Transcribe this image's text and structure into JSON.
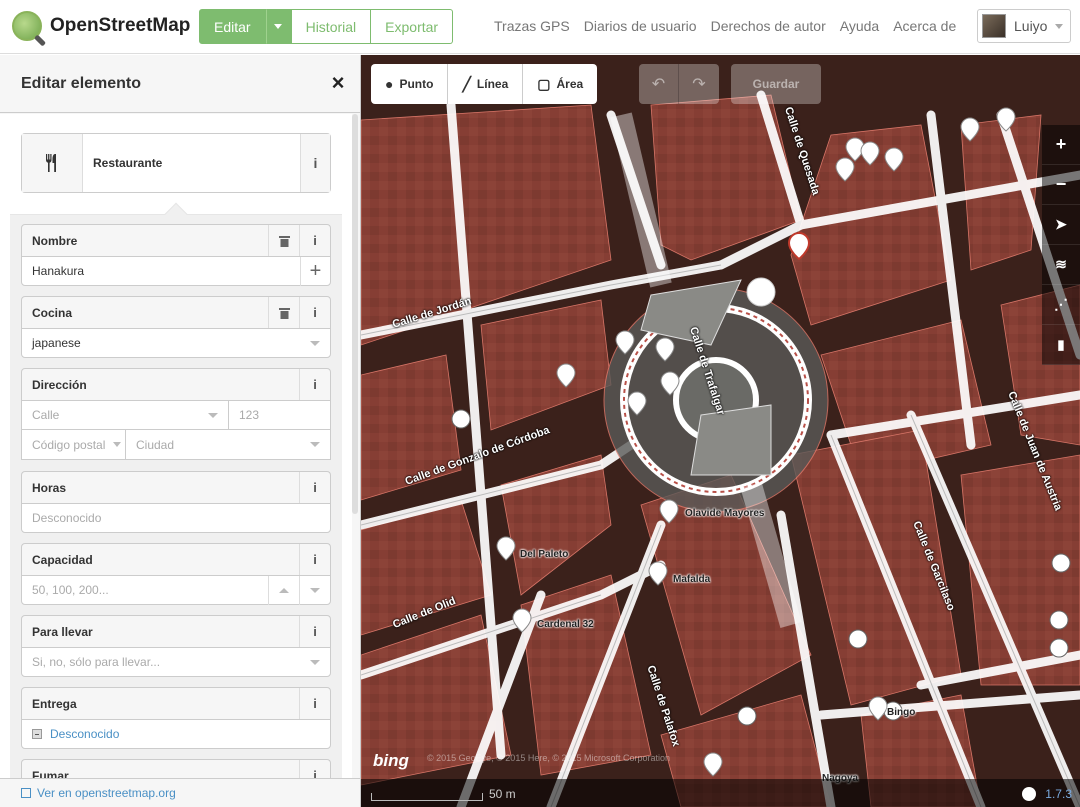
{
  "header": {
    "logo_text": "OpenStreetMap",
    "edit_label": "Editar",
    "history_label": "Historial",
    "export_label": "Exportar",
    "nav": [
      "Trazas GPS",
      "Diarios de usuario",
      "Derechos de autor",
      "Ayuda",
      "Acerca de"
    ],
    "user_name": "Luiyo"
  },
  "sidebar": {
    "title": "Editar elemento",
    "close_glyph": "×",
    "preset": {
      "icon": "restaurant-icon",
      "label": "Restaurante",
      "info": "i"
    },
    "fields": {
      "nombre": {
        "label": "Nombre",
        "value": "Hanakura"
      },
      "cocina": {
        "label": "Cocina",
        "value": "japanese"
      },
      "direccion": {
        "label": "Dirección",
        "street_ph": "Calle",
        "number_ph": "123",
        "postcode_ph": "Código postal",
        "city_ph": "Ciudad"
      },
      "horas": {
        "label": "Horas",
        "placeholder": "Desconocido"
      },
      "capacidad": {
        "label": "Capacidad",
        "placeholder": "50, 100, 200..."
      },
      "para_llevar": {
        "label": "Para llevar",
        "placeholder": "Si, no, sólo para llevar..."
      },
      "entrega": {
        "label": "Entrega",
        "value": "Desconocido"
      },
      "fumar": {
        "label": "Fumar"
      }
    },
    "footer_link": "Ver en openstreetmap.org"
  },
  "map": {
    "toolbar": {
      "point": "Punto",
      "line": "Línea",
      "area": "Área",
      "save": "Guardar"
    },
    "streets": [
      "Calle de Jordán",
      "Calle de Gonzalo de Córdoba",
      "Calle de Olid",
      "Calle de Quesada",
      "Calle de Trafalgar",
      "Calle de Palafox",
      "Calle de Garcilaso",
      "Calle de Juan de Austria"
    ],
    "pois": [
      "Olavide Mayores",
      "Del Paleto",
      "Mafalda",
      "Cardenal 32",
      "Bingo",
      "Nagoya"
    ],
    "attribution": "© 2015 GeoEye, © 2015 Here, © 2015 Microsoft Corporation",
    "bing": "bing",
    "scale": "50 m",
    "version": "1.7.3",
    "colors": {
      "accent": "#7ebc6f",
      "link": "#4a90c5",
      "building": "#8b4036"
    }
  }
}
